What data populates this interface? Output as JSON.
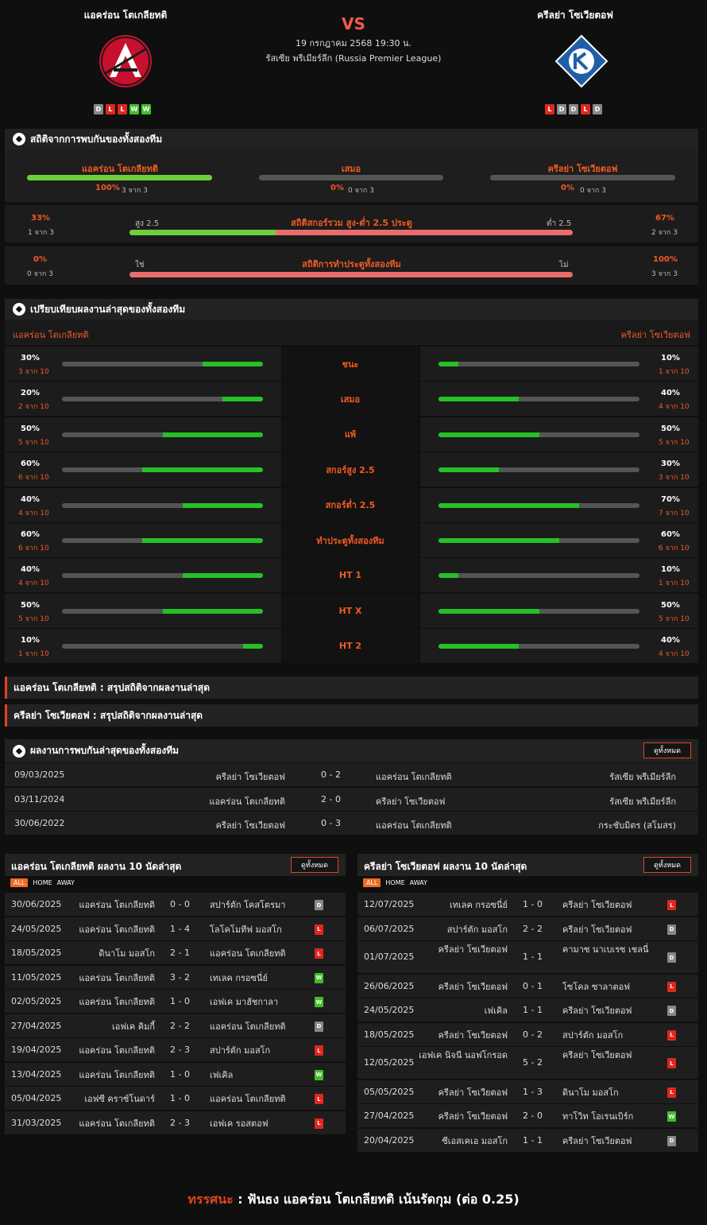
{
  "match": {
    "home": "แอคร่อน โตเกลียทติ",
    "away": "ครีลย่า โซเวียตอฟ",
    "vs": "VS",
    "date": "19 กรกฎาคม 2568 19:30 น.",
    "league": "รัสเซีย พรีเมียร์ลีก (Russia Premier League)",
    "home_form": [
      "D",
      "L",
      "L",
      "W",
      "W"
    ],
    "away_form": [
      "L",
      "D",
      "D",
      "L",
      "D"
    ]
  },
  "colors": {
    "accent": "#f05a23",
    "win": "#3fbf27",
    "loss": "#e0261f",
    "draw": "#888888",
    "bar_green": "#6fcf3a",
    "bar_red": "#ea6d6d"
  },
  "icons": {
    "section": "soccer-ball-icon",
    "home_logo": "akron-crest-icon",
    "away_logo": "krylia-sovetov-crest-icon"
  },
  "h2h_stats": {
    "title": "สถิติจากการพบกันของทั้งสองทีม",
    "home": {
      "label": "แอคร่อน โตเกลียทติ",
      "pct": "100%",
      "sub": "3 จาก 3",
      "fill": 1.0
    },
    "draw": {
      "label": "เสมอ",
      "pct": "0%",
      "sub": "0 จาก 3",
      "fill": 0
    },
    "away": {
      "label": "ครีลย่า โซเวียตอฟ",
      "pct": "0%",
      "sub": "0 จาก 3",
      "fill": 0
    },
    "ou": {
      "title": "สถิติสกอร์รวม สูง-ต่ำ 2.5 ประตู",
      "over_label": "สูง 2.5",
      "under_label": "ต่ำ 2.5",
      "left_pct": "33%",
      "left_sub": "1 จาก 3",
      "right_pct": "67%",
      "right_sub": "2 จาก 3",
      "fill": 0.33
    },
    "btts": {
      "title": "สถิติการทำประตูทั้งสองทีม",
      "yes_label": "ใช่",
      "no_label": "ไม่",
      "left_pct": "0%",
      "left_sub": "0 จาก 3",
      "right_pct": "100%",
      "right_sub": "3 จาก 3",
      "fill": 0
    }
  },
  "compare": {
    "title": "เปรียบเทียบผลงานล่าสุดของทั้งสองทีม",
    "home": "แอคร่อน โตเกลียทติ",
    "away": "ครีลย่า โซเวียตอฟ",
    "rows": [
      {
        "label": "ชนะ",
        "hp": "30%",
        "hs": "3 จาก 10",
        "hv": 0.3,
        "ap": "10%",
        "as": "1 จาก 10",
        "av": 0.1
      },
      {
        "label": "เสมอ",
        "hp": "20%",
        "hs": "2 จาก 10",
        "hv": 0.2,
        "ap": "40%",
        "as": "4 จาก 10",
        "av": 0.4
      },
      {
        "label": "แพ้",
        "hp": "50%",
        "hs": "5 จาก 10",
        "hv": 0.5,
        "ap": "50%",
        "as": "5 จาก 10",
        "av": 0.5
      },
      {
        "label": "สกอร์สูง 2.5",
        "hp": "60%",
        "hs": "6 จาก 10",
        "hv": 0.6,
        "ap": "30%",
        "as": "3 จาก 10",
        "av": 0.3
      },
      {
        "label": "สกอร์ต่ำ 2.5",
        "hp": "40%",
        "hs": "4 จาก 10",
        "hv": 0.4,
        "ap": "70%",
        "as": "7 จาก 10",
        "av": 0.7
      },
      {
        "label": "ทำประตูทั้งสองทีม",
        "hp": "60%",
        "hs": "6 จาก 10",
        "hv": 0.6,
        "ap": "60%",
        "as": "6 จาก 10",
        "av": 0.6
      },
      {
        "label": "HT 1",
        "hp": "40%",
        "hs": "4 จาก 10",
        "hv": 0.4,
        "ap": "10%",
        "as": "1 จาก 10",
        "av": 0.1
      },
      {
        "label": "HT X",
        "hp": "50%",
        "hs": "5 จาก 10",
        "hv": 0.5,
        "ap": "50%",
        "as": "5 จาก 10",
        "av": 0.5
      },
      {
        "label": "HT 2",
        "hp": "10%",
        "hs": "1 จาก 10",
        "hv": 0.1,
        "ap": "40%",
        "as": "4 จาก 10",
        "av": 0.4
      }
    ]
  },
  "summaries": [
    "แอคร่อน โตเกลียทติ : สรุปสถิติจากผลงานล่าสุด",
    "ครีลย่า โซเวียตอฟ : สรุปสถิติจากผลงานล่าสุด"
  ],
  "h2h": {
    "title": "ผลงานการพบกันล่าสุดของทั้งสองทีม",
    "view_all": "ดูทั้งหมด",
    "rows": [
      {
        "date": "09/03/2025",
        "home": "ครีลย่า โซเวียตอฟ",
        "score": "0 - 2",
        "away": "แอคร่อน โตเกลียทติ",
        "comp": "รัสเซีย พรีเมียร์ลีก"
      },
      {
        "date": "03/11/2024",
        "home": "แอคร่อน โตเกลียทติ",
        "score": "2 - 0",
        "away": "ครีลย่า โซเวียตอฟ",
        "comp": "รัสเซีย พรีเมียร์ลีก"
      },
      {
        "date": "30/06/2022",
        "home": "ครีลย่า โซเวียตอฟ",
        "score": "0 - 3",
        "away": "แอคร่อน โตเกลียทติ",
        "comp": "กระชับมิตร (สโมสร)"
      }
    ]
  },
  "last10": {
    "tabs": [
      "ALL",
      "HOME",
      "AWAY"
    ],
    "view_all": "ดูทั้งหมด",
    "home_title": "แอคร่อน โตเกลียทติ ผลงาน 10 นัดล่าสุด",
    "away_title": "ครีลย่า โซเวียตอฟ ผลงาน 10 นัดล่าสุด",
    "home": [
      {
        "date": "30/06/2025",
        "h": "แอคร่อน โตเกลียทติ",
        "s": "0 - 0",
        "a": "สปาร์ตัก โคสโตรมา",
        "r": "D"
      },
      {
        "date": "24/05/2025",
        "h": "แอคร่อน โตเกลียทติ",
        "s": "1 - 4",
        "a": "โลโคโมทีฟ มอสโก",
        "r": "L"
      },
      {
        "date": "18/05/2025",
        "h": "ดินาโม มอสโก",
        "s": "2 - 1",
        "a": "แอคร่อน โตเกลียทติ",
        "r": "L"
      },
      {
        "date": "11/05/2025",
        "h": "แอคร่อน โตเกลียทติ",
        "s": "3 - 2",
        "a": "เทเลค กรอซนี่ย์",
        "r": "W"
      },
      {
        "date": "02/05/2025",
        "h": "แอคร่อน โตเกลียทติ",
        "s": "1 - 0",
        "a": "เอฟเค มาฮัชกาลา",
        "r": "W"
      },
      {
        "date": "27/04/2025",
        "h": "เอฟเค คิมกี้",
        "s": "2 - 2",
        "a": "แอคร่อน โตเกลียทติ",
        "r": "D"
      },
      {
        "date": "19/04/2025",
        "h": "แอคร่อน โตเกลียทติ",
        "s": "2 - 3",
        "a": "สปาร์ตัก มอสโก",
        "r": "L"
      },
      {
        "date": "13/04/2025",
        "h": "แอคร่อน โตเกลียทติ",
        "s": "1 - 0",
        "a": "เฟเคิล",
        "r": "W"
      },
      {
        "date": "05/04/2025",
        "h": "เอฟซี คราซ์โนดาร์",
        "s": "1 - 0",
        "a": "แอคร่อน โตเกลียทติ",
        "r": "L"
      },
      {
        "date": "31/03/2025",
        "h": "แอคร่อน โตเกลียทติ",
        "s": "2 - 3",
        "a": "เอฟเค รอสตอฟ",
        "r": "L"
      }
    ],
    "away": [
      {
        "date": "12/07/2025",
        "h": "เทเลค กรอซนี่ย์",
        "s": "1 - 0",
        "a": "ครีลย่า โซเวียตอฟ",
        "r": "L"
      },
      {
        "date": "06/07/2025",
        "h": "สปาร์ตัก มอสโก",
        "s": "2 - 2",
        "a": "ครีลย่า โซเวียตอฟ",
        "r": "D"
      },
      {
        "date": "01/07/2025",
        "h": "ครีลย่า โซเวียตอฟ",
        "s": "1 - 1",
        "a": "คามาซ นาเบเรซ เชลนี่",
        "r": "D",
        "tall": true
      },
      {
        "date": "26/06/2025",
        "h": "ครีลย่า โซเวียตอฟ",
        "s": "0 - 1",
        "a": "โซโคล ซาลาตอฟ",
        "r": "L"
      },
      {
        "date": "24/05/2025",
        "h": "เฟเคิล",
        "s": "1 - 1",
        "a": "ครีลย่า โซเวียตอฟ",
        "r": "D"
      },
      {
        "date": "18/05/2025",
        "h": "ครีลย่า โซเวียตอฟ",
        "s": "0 - 2",
        "a": "สปาร์ตัก มอสโก",
        "r": "L"
      },
      {
        "date": "12/05/2025",
        "h": "เอฟเค นิจนี นอฟโกรอด",
        "s": "5 - 2",
        "a": "ครีลย่า โซเวียตอฟ",
        "r": "L",
        "tall": true
      },
      {
        "date": "05/05/2025",
        "h": "ครีลย่า โซเวียตอฟ",
        "s": "1 - 3",
        "a": "ดินาโม มอสโก",
        "r": "L"
      },
      {
        "date": "27/04/2025",
        "h": "ครีลย่า โซเวียตอฟ",
        "s": "2 - 0",
        "a": "ทาโวิท โอเรนเบิร์ก",
        "r": "W"
      },
      {
        "date": "20/04/2025",
        "h": "ซีเอสเคเอ มอสโก",
        "s": "1 - 1",
        "a": "ครีลย่า โซเวียตอฟ",
        "r": "D"
      }
    ]
  },
  "recommendation": {
    "label": "ทรรศนะ",
    "sep": " : ",
    "text": "ฟันธง แอคร่อน โตเกลียทติ เน้นรัดกุม (ต่อ 0.25)"
  }
}
